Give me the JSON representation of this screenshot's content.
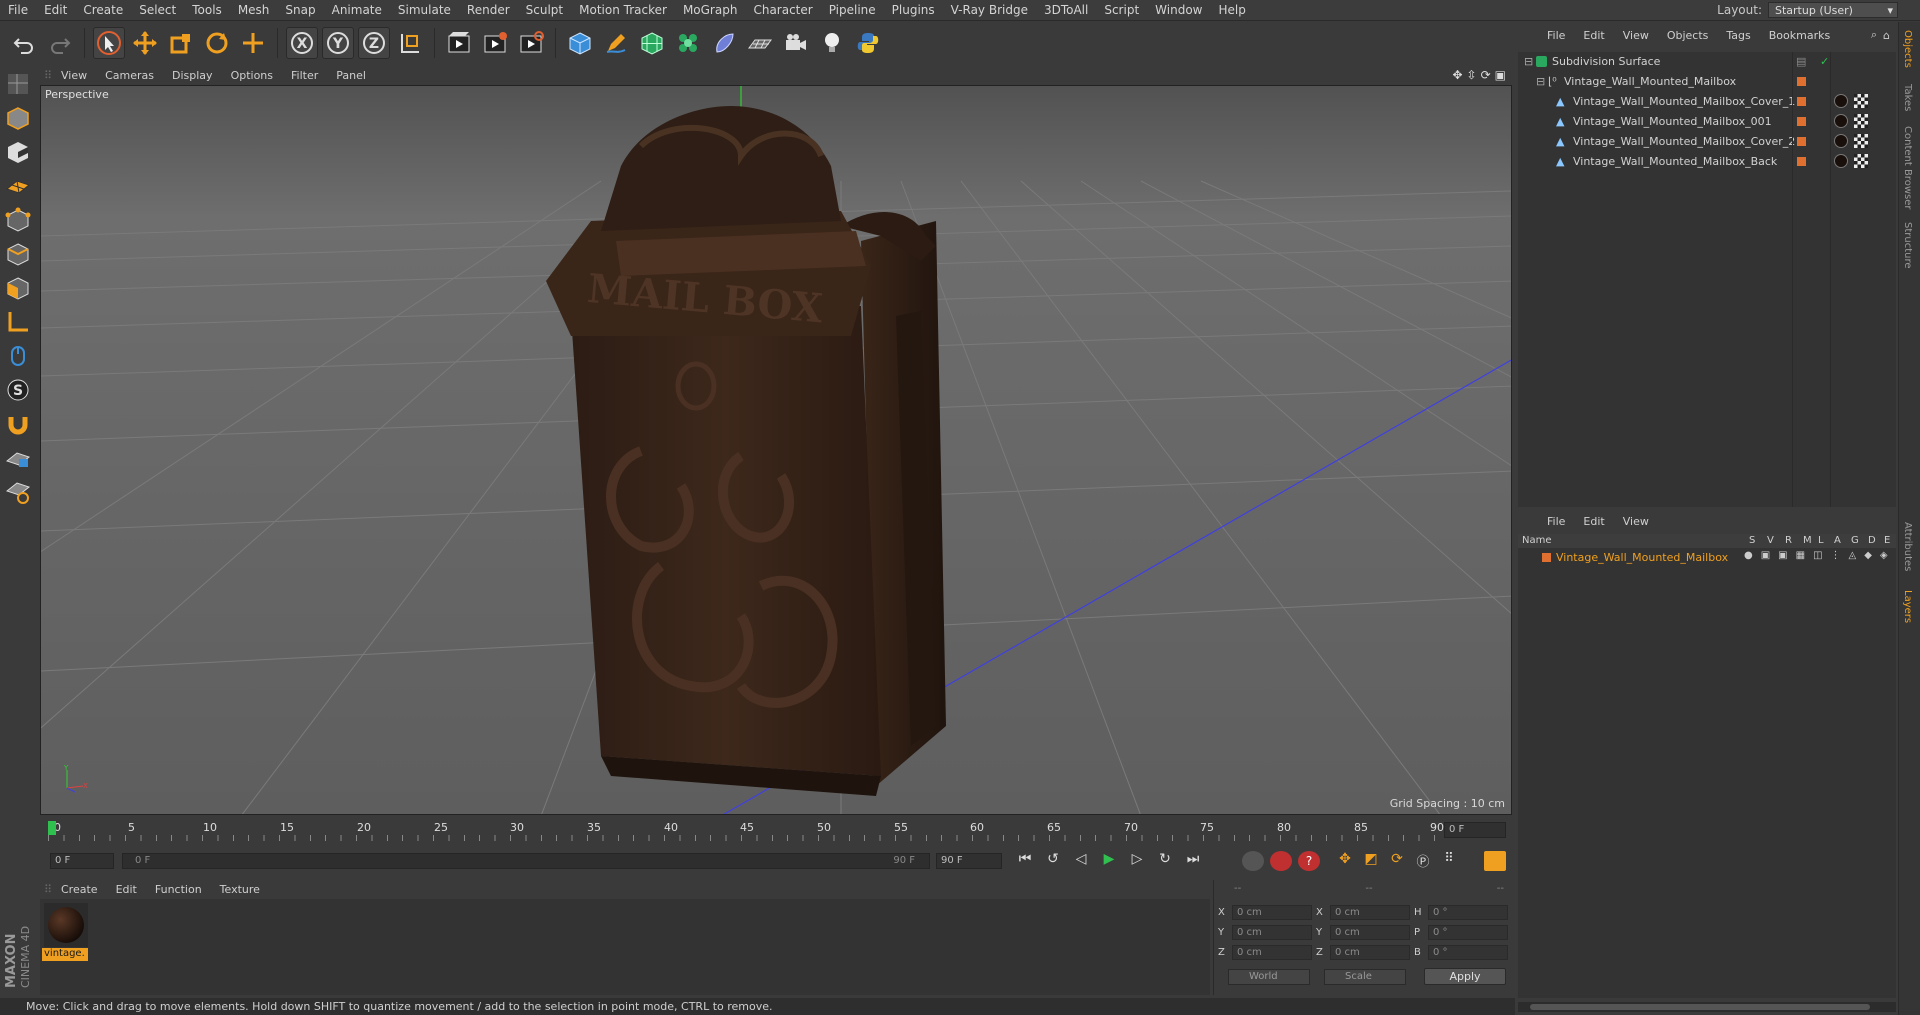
{
  "menubar": {
    "items": [
      "File",
      "Edit",
      "Create",
      "Select",
      "Tools",
      "Mesh",
      "Snap",
      "Animate",
      "Simulate",
      "Render",
      "Sculpt",
      "Motion Tracker",
      "MoGraph",
      "Character",
      "Pipeline",
      "Plugins",
      "V-Ray Bridge",
      "3DToAll",
      "Script",
      "Window",
      "Help"
    ],
    "layout_label": "Layout:",
    "layout_value": "Startup (User)"
  },
  "toolbar": {
    "icons": [
      "undo-icon",
      "redo-icon",
      "live-selection-icon",
      "move-icon",
      "scale-icon",
      "rotate-icon",
      "recent-tool-icon",
      "x-axis-icon",
      "y-axis-icon",
      "z-axis-icon",
      "coordinate-system-icon",
      "render-view-icon",
      "render-picture-viewer-icon",
      "edit-render-settings-icon",
      "cube-icon",
      "pen-icon",
      "subdivision-icon",
      "cloner-icon",
      "deformer-icon",
      "floor-icon",
      "camera-icon",
      "light-icon",
      "python-icon"
    ]
  },
  "viewport": {
    "menu": [
      "View",
      "Cameras",
      "Display",
      "Options",
      "Filter",
      "Panel"
    ],
    "label": "Perspective",
    "grid_spacing": "Grid Spacing : 10 cm",
    "object_text": "MAIL BOX"
  },
  "timeline": {
    "ticks": [
      "0",
      "5",
      "10",
      "15",
      "20",
      "25",
      "30",
      "35",
      "40",
      "45",
      "50",
      "55",
      "60",
      "65",
      "70",
      "75",
      "80",
      "85",
      "90"
    ],
    "current_frame": "0 F"
  },
  "transport": {
    "start_field": "0 F",
    "slider_start": "0 F",
    "slider_end": "90 F",
    "end_field": "90 F"
  },
  "material_manager": {
    "menu": [
      "Create",
      "Edit",
      "Function",
      "Texture"
    ],
    "materials": [
      {
        "name": "vintage."
      }
    ]
  },
  "coordinates": {
    "header": [
      "--",
      "--",
      "--"
    ],
    "rows": [
      {
        "a": "X",
        "pos": "0 cm",
        "b": "X",
        "size": "0 cm",
        "c": "H",
        "rot": "0 °"
      },
      {
        "a": "Y",
        "pos": "0 cm",
        "b": "Y",
        "size": "0 cm",
        "c": "P",
        "rot": "0 °"
      },
      {
        "a": "Z",
        "pos": "0 cm",
        "b": "Z",
        "size": "0 cm",
        "c": "B",
        "rot": "0 °"
      }
    ],
    "mode1": "World",
    "mode2": "Scale",
    "apply": "Apply"
  },
  "status_bar": "Move: Click and drag to move elements. Hold down SHIFT to quantize movement / add to the selection in point mode, CTRL to remove.",
  "object_manager": {
    "menu": [
      "File",
      "Edit",
      "View",
      "Objects",
      "Tags",
      "Bookmarks"
    ],
    "objects": [
      {
        "name": "Subdivision Surface"
      },
      {
        "name": "Vintage_Wall_Mounted_Mailbox"
      },
      {
        "name": "Vintage_Wall_Mounted_Mailbox_Cover_1"
      },
      {
        "name": "Vintage_Wall_Mounted_Mailbox_001"
      },
      {
        "name": "Vintage_Wall_Mounted_Mailbox_Cover_2"
      },
      {
        "name": "Vintage_Wall_Mounted_Mailbox_Back"
      }
    ]
  },
  "layer_manager": {
    "menu": [
      "File",
      "Edit",
      "View"
    ],
    "header_name": "Name",
    "columns": [
      "S",
      "V",
      "R",
      "M",
      "L",
      "A",
      "G",
      "D",
      "E"
    ],
    "layers": [
      {
        "name": "Vintage_Wall_Mounted_Mailbox"
      }
    ]
  },
  "right_tabs": [
    "Objects",
    "Takes",
    "Content Browser",
    "Structure",
    "Attributes",
    "Layers"
  ],
  "colors": {
    "accent": "#f0a020",
    "layer_color": "#e07030"
  }
}
